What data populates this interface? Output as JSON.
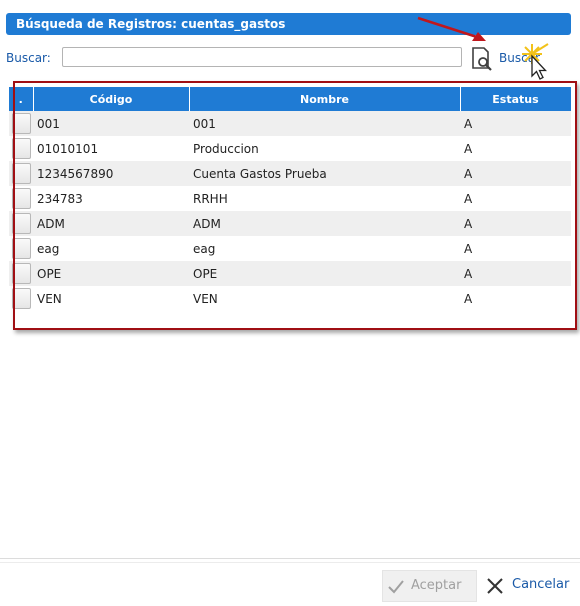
{
  "dialog": {
    "title": "Búsqueda de Registros: cuentas_gastos"
  },
  "search": {
    "label": "Buscar:",
    "value": "",
    "placeholder": "",
    "button_label": "Buscar"
  },
  "table": {
    "columns": [
      ".",
      "Código",
      "Nombre",
      "Estatus"
    ],
    "rows": [
      {
        "codigo": "001",
        "nombre": "001",
        "estatus": "A"
      },
      {
        "codigo": "01010101",
        "nombre": "Produccion",
        "estatus": "A"
      },
      {
        "codigo": "1234567890",
        "nombre": "Cuenta Gastos Prueba",
        "estatus": "A"
      },
      {
        "codigo": "234783",
        "nombre": "RRHH",
        "estatus": "A"
      },
      {
        "codigo": "ADM",
        "nombre": "ADM",
        "estatus": "A"
      },
      {
        "codigo": "eag",
        "nombre": "eag",
        "estatus": "A"
      },
      {
        "codigo": "OPE",
        "nombre": "OPE",
        "estatus": "A"
      },
      {
        "codigo": "VEN",
        "nombre": "VEN",
        "estatus": "A"
      }
    ]
  },
  "footer": {
    "accept_label": "Aceptar",
    "cancel_label": "Cancelar"
  },
  "colors": {
    "header_blue": "#1f7bd4",
    "link_blue": "#1a5aa8",
    "annotation_red": "#a00f14"
  },
  "icons": {
    "search_button": "document-search-icon",
    "accept": "check-icon",
    "cancel": "close-icon"
  }
}
